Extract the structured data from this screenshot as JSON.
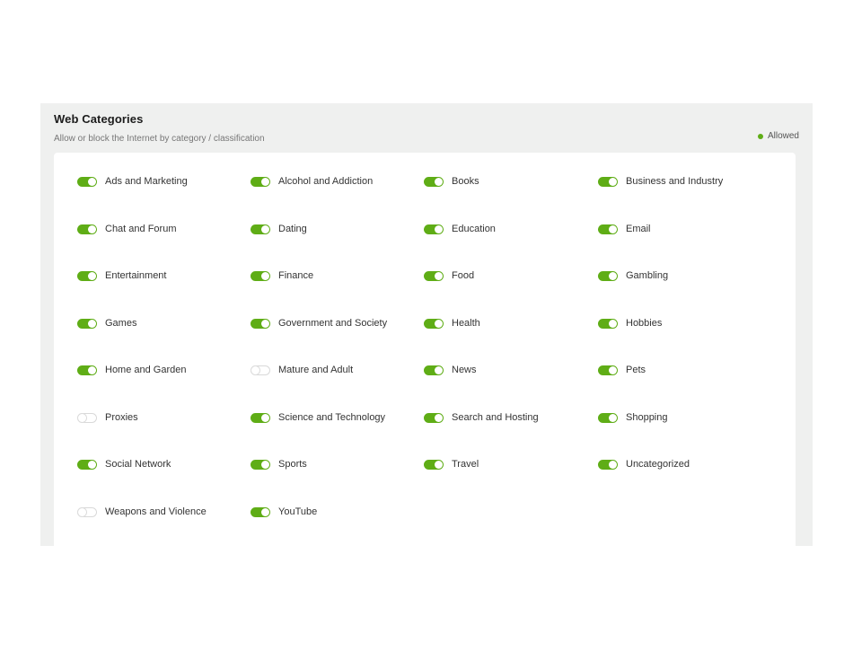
{
  "header": {
    "title": "Web Categories",
    "subtitle": "Allow or block the Internet by category / classification"
  },
  "legend": {
    "label": "Allowed",
    "color": "#5fad16"
  },
  "colors": {
    "toggle_on": "#5fad16",
    "toggle_off_border": "#d9d9d9",
    "panel_bg": "#eff0ef"
  },
  "categories": [
    {
      "label": "Ads and Marketing",
      "allowed": true
    },
    {
      "label": "Alcohol and Addiction",
      "allowed": true
    },
    {
      "label": "Books",
      "allowed": true
    },
    {
      "label": "Business and Industry",
      "allowed": true
    },
    {
      "label": "Chat and Forum",
      "allowed": true
    },
    {
      "label": "Dating",
      "allowed": true
    },
    {
      "label": "Education",
      "allowed": true
    },
    {
      "label": "Email",
      "allowed": true
    },
    {
      "label": "Entertainment",
      "allowed": true
    },
    {
      "label": "Finance",
      "allowed": true
    },
    {
      "label": "Food",
      "allowed": true
    },
    {
      "label": "Gambling",
      "allowed": true
    },
    {
      "label": "Games",
      "allowed": true
    },
    {
      "label": "Government and Society",
      "allowed": true
    },
    {
      "label": "Health",
      "allowed": true
    },
    {
      "label": "Hobbies",
      "allowed": true
    },
    {
      "label": "Home and Garden",
      "allowed": true
    },
    {
      "label": "Mature and Adult",
      "allowed": false
    },
    {
      "label": "News",
      "allowed": true
    },
    {
      "label": "Pets",
      "allowed": true
    },
    {
      "label": "Proxies",
      "allowed": false
    },
    {
      "label": "Science and Technology",
      "allowed": true
    },
    {
      "label": "Search and Hosting",
      "allowed": true
    },
    {
      "label": "Shopping",
      "allowed": true
    },
    {
      "label": "Social Network",
      "allowed": true
    },
    {
      "label": "Sports",
      "allowed": true
    },
    {
      "label": "Travel",
      "allowed": true
    },
    {
      "label": "Uncategorized",
      "allowed": true
    },
    {
      "label": "Weapons and Violence",
      "allowed": false
    },
    {
      "label": "YouTube",
      "allowed": true
    }
  ]
}
